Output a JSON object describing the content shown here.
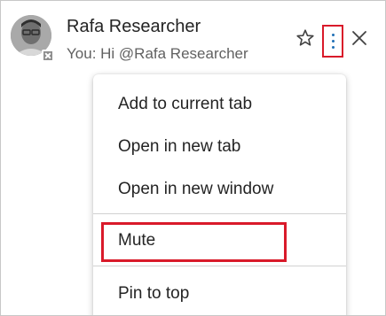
{
  "conversation": {
    "name": "Rafa Researcher",
    "preview": "You: Hi @Rafa Researcher"
  },
  "icons": {
    "favorite": "star-icon",
    "more": "more-options-icon",
    "close": "close-icon",
    "presence": "presence-offline-icon"
  },
  "menu": {
    "items": [
      {
        "label": "Add to current tab"
      },
      {
        "label": "Open in new tab"
      },
      {
        "label": "Open in new window"
      },
      {
        "label": "Mute"
      },
      {
        "label": "Pin to top"
      }
    ]
  },
  "colors": {
    "highlight": "#d91a2a",
    "accent": "#1f6fb5",
    "text": "#242424",
    "secondary_text": "#616161"
  }
}
